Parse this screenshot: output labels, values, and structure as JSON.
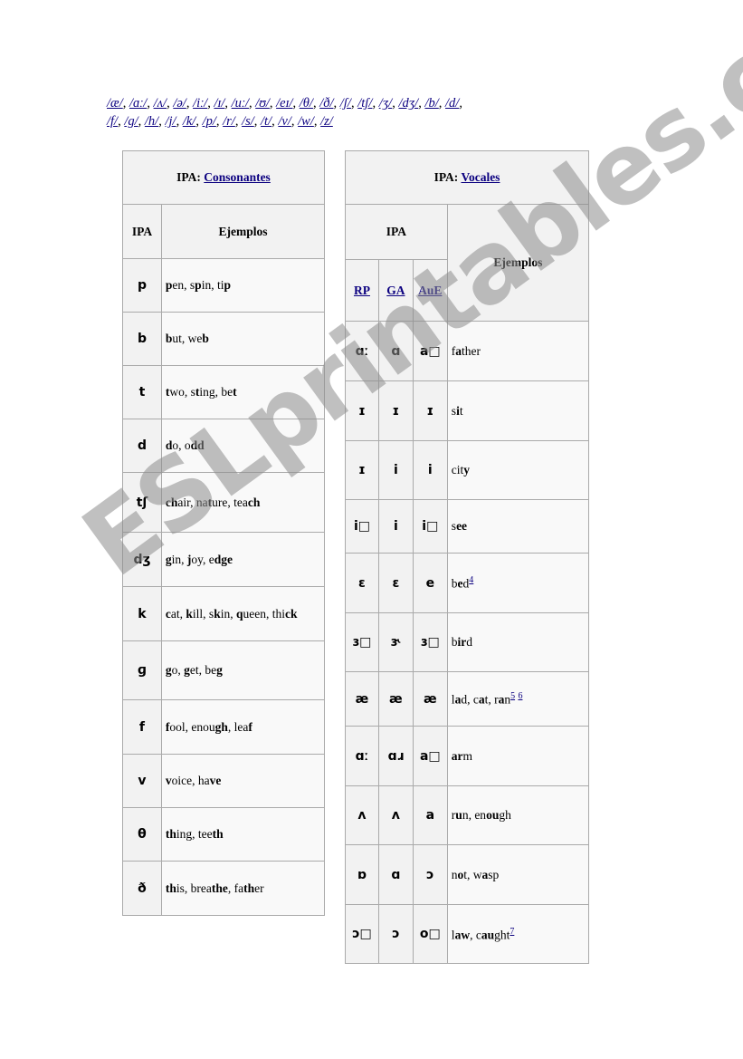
{
  "ipa_links": {
    "line1": [
      "/æ/",
      "/ɑː/",
      "/ʌ/",
      "/ə/",
      "/iː/",
      "/ɪ/",
      "/uː/",
      "/ʊ/",
      "/eɪ/",
      "/θ/",
      "/ð/",
      "/ʃ/",
      "/tʃ/",
      "/ʒ/",
      "/dʒ/",
      "/b/",
      "/d/"
    ],
    "line2": [
      "/f/",
      "/g/",
      "/h/",
      "/j/",
      "/k/",
      "/p/",
      "/r/",
      "/s/",
      "/t/",
      "/v/",
      "/w/",
      "/z/"
    ],
    "separator": ", "
  },
  "consonants": {
    "title_prefix": "IPA: ",
    "title_link": "Consonantes",
    "col_ipa": "IPA",
    "col_examples": "Ejemplos",
    "rows": [
      {
        "ipa": "p",
        "examples": [
          [
            "p",
            true
          ],
          [
            "en, s",
            false
          ],
          [
            "p",
            true
          ],
          [
            "in, ti",
            false
          ],
          [
            "p",
            true
          ]
        ]
      },
      {
        "ipa": "b",
        "examples": [
          [
            "b",
            true
          ],
          [
            "ut, we",
            false
          ],
          [
            "b",
            true
          ]
        ]
      },
      {
        "ipa": "t",
        "examples": [
          [
            "t",
            true
          ],
          [
            "wo, s",
            false
          ],
          [
            "t",
            true
          ],
          [
            "ing, be",
            false
          ],
          [
            "t",
            true
          ]
        ]
      },
      {
        "ipa": "d",
        "examples": [
          [
            "d",
            true
          ],
          [
            "o, o",
            false
          ],
          [
            "dd",
            true
          ]
        ]
      },
      {
        "ipa": "tʃ",
        "examples": [
          [
            "ch",
            true
          ],
          [
            "air, na",
            false
          ],
          [
            "t",
            true
          ],
          [
            "ure, tea",
            false
          ],
          [
            "ch",
            true
          ]
        ]
      },
      {
        "ipa": "dʒ",
        "examples": [
          [
            "g",
            true
          ],
          [
            "in, ",
            false
          ],
          [
            "j",
            true
          ],
          [
            "oy, e",
            false
          ],
          [
            "dge",
            true
          ]
        ]
      },
      {
        "ipa": "k",
        "examples": [
          [
            "c",
            true
          ],
          [
            "at, ",
            false
          ],
          [
            "k",
            true
          ],
          [
            "ill, s",
            false
          ],
          [
            "k",
            true
          ],
          [
            "in, ",
            false
          ],
          [
            "q",
            true
          ],
          [
            "ueen, thi",
            false
          ],
          [
            "ck",
            true
          ]
        ]
      },
      {
        "ipa": "ɡ",
        "examples": [
          [
            "g",
            true
          ],
          [
            "o, ",
            false
          ],
          [
            "g",
            true
          ],
          [
            "et, be",
            false
          ],
          [
            "g",
            true
          ]
        ]
      },
      {
        "ipa": "f",
        "examples": [
          [
            "f",
            true
          ],
          [
            "ool, enou",
            false
          ],
          [
            "gh",
            true
          ],
          [
            ", lea",
            false
          ],
          [
            "f",
            true
          ]
        ]
      },
      {
        "ipa": "v",
        "examples": [
          [
            "v",
            true
          ],
          [
            "oice, ha",
            false
          ],
          [
            "ve",
            true
          ]
        ]
      },
      {
        "ipa": "θ",
        "examples": [
          [
            "th",
            true
          ],
          [
            "ing, tee",
            false
          ],
          [
            "th",
            true
          ]
        ]
      },
      {
        "ipa": "ð",
        "examples": [
          [
            "th",
            true
          ],
          [
            "is, brea",
            false
          ],
          [
            "the",
            true
          ],
          [
            ", fa",
            false
          ],
          [
            "th",
            true
          ],
          [
            "er",
            false
          ]
        ]
      }
    ]
  },
  "vowels": {
    "title_prefix": "IPA: ",
    "title_link": "Vocales",
    "col_ipa": "IPA",
    "col_examples": "Ejemplos",
    "sub_cols": [
      "RP",
      "GA",
      "AuE"
    ],
    "rows": [
      {
        "rp": "ɑː",
        "ga": "ɑ",
        "aue": "a□",
        "examples": [
          [
            "f",
            false
          ],
          [
            "a",
            true
          ],
          [
            "ther",
            false
          ]
        ],
        "notes": []
      },
      {
        "rp": "ɪ",
        "ga": "ɪ",
        "aue": "ɪ",
        "examples": [
          [
            "s",
            false
          ],
          [
            "i",
            true
          ],
          [
            "t",
            false
          ]
        ],
        "notes": []
      },
      {
        "rp": "ɪ",
        "ga": "i",
        "aue": "i",
        "examples": [
          [
            "cit",
            false
          ],
          [
            "y",
            true
          ]
        ],
        "notes": []
      },
      {
        "rp": "i□",
        "ga": "i",
        "aue": "i□",
        "examples": [
          [
            "s",
            false
          ],
          [
            "ee",
            true
          ]
        ],
        "notes": []
      },
      {
        "rp": "ɛ",
        "ga": "ɛ",
        "aue": "e",
        "examples": [
          [
            "b",
            false
          ],
          [
            "e",
            true
          ],
          [
            "d",
            false
          ]
        ],
        "notes": [
          "4"
        ]
      },
      {
        "rp": "ɜ□",
        "ga": "ɝ",
        "aue": "ɜ□",
        "examples": [
          [
            "b",
            false
          ],
          [
            "ir",
            true
          ],
          [
            "d",
            false
          ]
        ],
        "notes": []
      },
      {
        "rp": "æ",
        "ga": "æ",
        "aue": "æ",
        "examples": [
          [
            "l",
            false
          ],
          [
            "a",
            true
          ],
          [
            "d, c",
            false
          ],
          [
            "a",
            true
          ],
          [
            "t, r",
            false
          ],
          [
            "a",
            true
          ],
          [
            "n",
            false
          ]
        ],
        "notes": [
          "5",
          "6"
        ]
      },
      {
        "rp": "ɑː",
        "ga": "ɑɹ",
        "aue": "a□",
        "examples": [
          [
            "ar",
            true
          ],
          [
            "m",
            false
          ]
        ],
        "notes": []
      },
      {
        "rp": "ʌ",
        "ga": "ʌ",
        "aue": "a",
        "examples": [
          [
            "r",
            false
          ],
          [
            "u",
            true
          ],
          [
            "n, en",
            false
          ],
          [
            "ou",
            true
          ],
          [
            "gh",
            false
          ]
        ],
        "notes": []
      },
      {
        "rp": "ɒ",
        "ga": "ɑ",
        "aue": "ɔ",
        "examples": [
          [
            "n",
            false
          ],
          [
            "o",
            true
          ],
          [
            "t, w",
            false
          ],
          [
            "a",
            true
          ],
          [
            "sp",
            false
          ]
        ],
        "notes": []
      },
      {
        "rp": "ɔ□",
        "ga": "ɔ",
        "aue": "o□",
        "examples": [
          [
            "l",
            false
          ],
          [
            "aw",
            true
          ],
          [
            ", c",
            false
          ],
          [
            "au",
            true
          ],
          [
            "ght",
            false
          ]
        ],
        "notes": [
          "7"
        ]
      }
    ]
  },
  "watermark": "ESLprintables.com"
}
